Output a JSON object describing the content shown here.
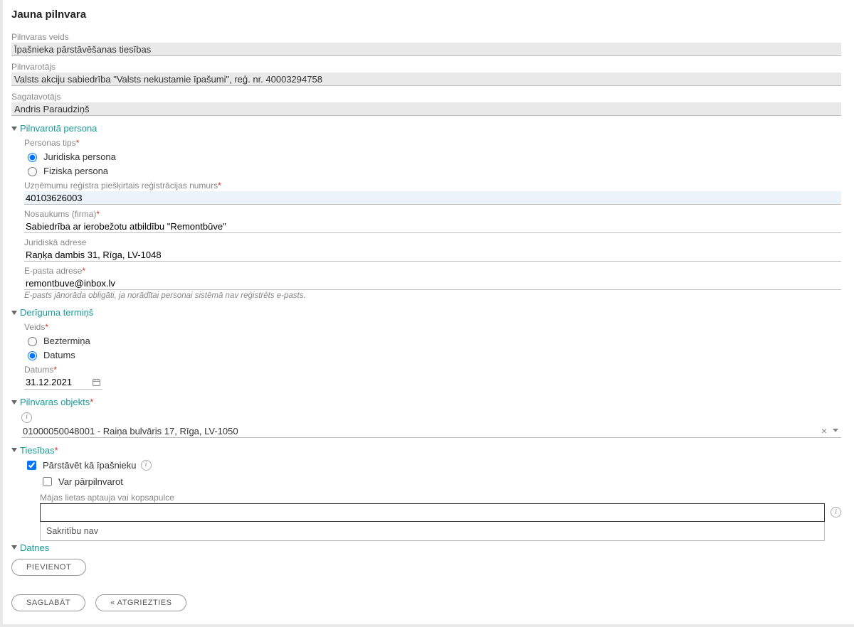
{
  "title": "Jauna pilnvara",
  "fields": {
    "pilnvaras_veids": {
      "label": "Pilnvaras veids",
      "value": "Īpašnieka pārstāvēšanas tiesības"
    },
    "pilnvarotajs": {
      "label": "Pilnvarotājs",
      "value": "Valsts akciju sabiedrība \"Valsts nekustamie īpašumi\", reģ. nr. 40003294758"
    },
    "sagatavotajs": {
      "label": "Sagatavotājs",
      "value": "Andris Paraudziņš"
    }
  },
  "sections": {
    "persona": {
      "title": "Pilnvarotā persona",
      "type_label": "Personas tips",
      "type_options": {
        "juridiska": "Juridiska persona",
        "fiziska": "Fiziska persona"
      },
      "type_selected": "juridiska",
      "regnr": {
        "label": "Uzņēmumu reģistra piešķirtais reģistrācijas numurs",
        "value": "40103626003"
      },
      "name": {
        "label": "Nosaukums (firma)",
        "value": "Sabiedrība ar ierobežotu atbildību \"Remontbūve\""
      },
      "address": {
        "label": "Juridiskā adrese",
        "value": "Raņķa dambis 31, Rīga, LV-1048"
      },
      "email": {
        "label": "E-pasta adrese",
        "value": "remontbuve@inbox.lv",
        "hint": "E-pasts jānorāda obligāti, ja norādītai personai sistēmā nav reģistrēts e-pasts."
      }
    },
    "termins": {
      "title": "Derīguma termiņš",
      "veids_label": "Veids",
      "options": {
        "beztermina": "Beztermiņa",
        "datums": "Datums"
      },
      "selected": "datums",
      "date_label": "Datums",
      "date_value": "31.12.2021"
    },
    "objekts": {
      "title": "Pilnvaras objekts",
      "value": "01000050048001 - Raiņa bulvāris 17, Rīga, LV-1050"
    },
    "tiesibas": {
      "title": "Tiesības",
      "parstavet": {
        "label": "Pārstāvēt kā īpašnieku",
        "checked": true
      },
      "parpilnvarot": {
        "label": "Var pārpilnvarot",
        "checked": false
      },
      "majas_label": "Mājas lietas aptauja vai kopsapulce",
      "majas_value": "",
      "no_match": "Sakritību nav"
    },
    "datnes": {
      "title": "Datnes",
      "add_btn": "Pievienot"
    }
  },
  "buttons": {
    "save": "Saglabāt",
    "back": "« Atgriezties"
  }
}
